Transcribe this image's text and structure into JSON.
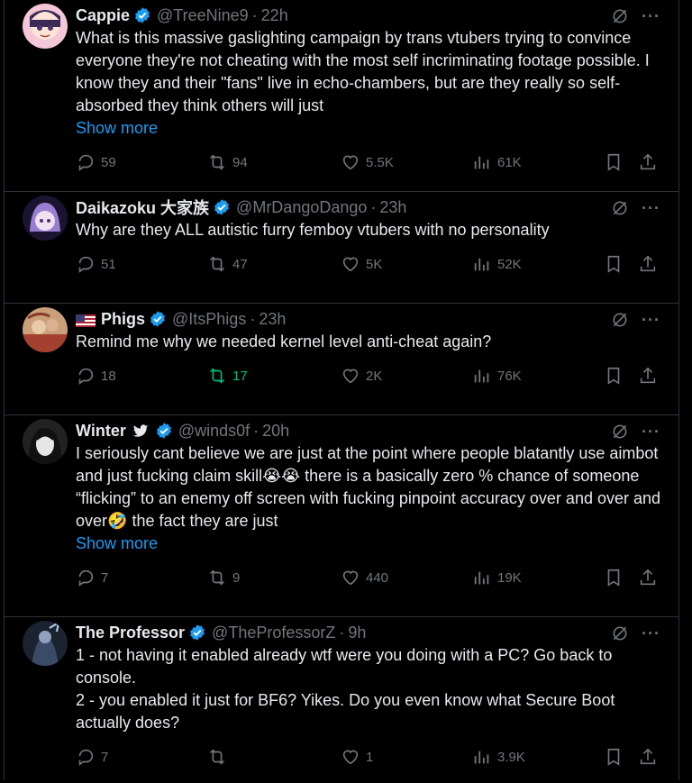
{
  "tweets": [
    {
      "name": "Cappie",
      "handle": "@TreeNine9",
      "time": "22h",
      "text": "What is this massive gaslighting campaign by trans vtubers trying to convince everyone they're not cheating with the most self incriminating footage possible. I know they and their \"fans\" live in echo-chambers, but are they really so self-absorbed they think others will just",
      "show_more": "Show more",
      "replies": "59",
      "reposts": "94",
      "likes": "5.5K",
      "views": "61K"
    },
    {
      "name": "Daikazoku 大家族",
      "handle": "@MrDangoDango",
      "time": "23h",
      "text": "Why are they ALL autistic furry femboy vtubers with no personality",
      "replies": "51",
      "reposts": "47",
      "likes": "5K",
      "views": "52K"
    },
    {
      "name": "Phigs",
      "handle": "@ItsPhigs",
      "time": "23h",
      "text": "Remind me why we needed kernel level anti-cheat again?",
      "replies": "18",
      "reposts": "17",
      "likes": "2K",
      "views": "76K"
    },
    {
      "name": "Winter",
      "handle": "@winds0f",
      "time": "20h",
      "text_parts": [
        "I seriously cant believe we are just at the point where people blatantly use aimbot and just fucking claim skill",
        "😭😭",
        " there is a basically zero % chance of someone “flicking” to an enemy off screen with fucking pinpoint accuracy over and over and over",
        "🤣",
        " the fact they are just"
      ],
      "show_more": "Show more",
      "replies": "7",
      "reposts": "9",
      "likes": "440",
      "views": "19K"
    },
    {
      "name": "The Professor",
      "handle": "@TheProfessorZ",
      "time": "9h",
      "text": "1 - not having it enabled already wtf were you doing with a PC? Go back to console.\n2 - you enabled it just for BF6? Yikes. Do you even know what Secure Boot actually does?",
      "replies": "7",
      "reposts": "",
      "likes": "1",
      "views": "3.9K"
    }
  ],
  "colors": {
    "accent": "#1d9bf0",
    "repost_active": "#00ba7c",
    "muted": "#71767b"
  },
  "icons": [
    "verified-badge-icon",
    "grok-icon",
    "more-icon",
    "reply-icon",
    "repost-icon",
    "like-icon",
    "views-icon",
    "bookmark-icon",
    "share-icon",
    "bird-icon",
    "us-flag-icon"
  ]
}
